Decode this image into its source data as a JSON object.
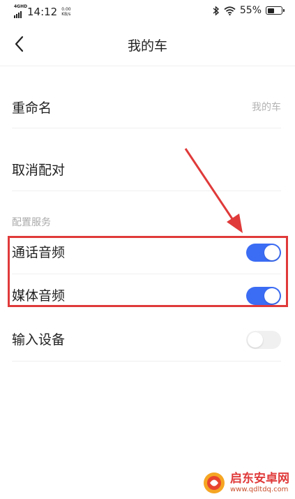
{
  "status_bar": {
    "network": "4GHD",
    "time": "14:12",
    "speed_value": "0.00",
    "speed_unit": "KB/s",
    "battery_percent": "55%",
    "battery_level": 0.55
  },
  "nav": {
    "title": "我的车"
  },
  "rows": {
    "rename": {
      "label": "重命名",
      "value": "我的车"
    },
    "unpair": {
      "label": "取消配对"
    }
  },
  "section": {
    "header": "配置服务",
    "items": [
      {
        "label": "通话音频",
        "enabled": true
      },
      {
        "label": "媒体音频",
        "enabled": true
      },
      {
        "label": "输入设备",
        "enabled": false
      }
    ]
  },
  "colors": {
    "accent": "#3b6cf4",
    "annotation": "#e03a3a"
  },
  "watermark": {
    "name": "启东安卓网",
    "url": "www.qdltdq.com"
  }
}
